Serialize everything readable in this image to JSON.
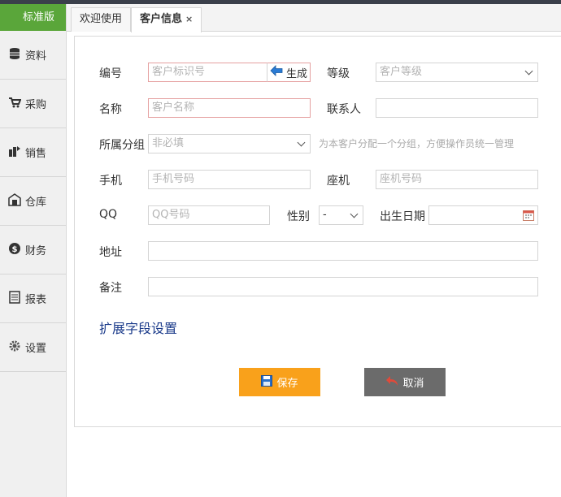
{
  "sidebar": {
    "edition": "标准版",
    "items": [
      {
        "label": "资料",
        "icon": "database-icon"
      },
      {
        "label": "采购",
        "icon": "cart-icon"
      },
      {
        "label": "销售",
        "icon": "sales-icon"
      },
      {
        "label": "仓库",
        "icon": "warehouse-icon"
      },
      {
        "label": "财务",
        "icon": "dollar-icon"
      },
      {
        "label": "报表",
        "icon": "report-icon"
      },
      {
        "label": "设置",
        "icon": "gear-icon"
      }
    ]
  },
  "tabs": [
    {
      "label": "欢迎使用",
      "active": false
    },
    {
      "label": "客户信息",
      "active": true,
      "close": "×"
    }
  ],
  "form": {
    "number": {
      "label": "编号",
      "placeholder": "客户标识号",
      "generate_label": "生成"
    },
    "level": {
      "label": "等级",
      "placeholder": "客户等级"
    },
    "name": {
      "label": "名称",
      "placeholder": "客户名称"
    },
    "contact": {
      "label": "联系人",
      "value": ""
    },
    "group": {
      "label": "所属分组",
      "placeholder": "非必填",
      "hint": "为本客户分配一个分组，方便操作员统一管理"
    },
    "mobile": {
      "label": "手机",
      "placeholder": "手机号码"
    },
    "phone": {
      "label": "座机",
      "placeholder": "座机号码"
    },
    "qq": {
      "label": "QQ",
      "placeholder": "QQ号码"
    },
    "gender": {
      "label": "性别",
      "value": "-"
    },
    "birthday": {
      "label": "出生日期",
      "value": ""
    },
    "address": {
      "label": "地址",
      "value": ""
    },
    "remark": {
      "label": "备注",
      "value": ""
    },
    "ext_link": "扩展字段设置"
  },
  "actions": {
    "save": "保存",
    "cancel": "取消"
  },
  "colors": {
    "edition_bg": "#5aa63a",
    "save_bg": "#f9a11b",
    "cancel_bg": "#6b6b6b",
    "required_border": "#e5a0a0",
    "link": "#1a3a8a"
  }
}
